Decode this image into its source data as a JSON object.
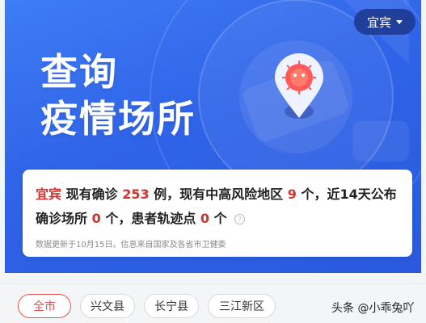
{
  "header": {
    "city": "宜宾",
    "title_line1": "查询",
    "title_line2": "疫情场所"
  },
  "summary": {
    "city": "宜宾",
    "t1": "现有确诊",
    "confirmed": "253",
    "t2": "例，现有中高风险地区",
    "risk_areas": "9",
    "t3": "个，近14天公布",
    "t4": "确诊场所",
    "places": "0",
    "t5": "个，患者轨迹点",
    "tracks": "0",
    "t6": "个",
    "note": "数据更新于10月15日。信息来自国家及各省市卫健委"
  },
  "tabs": [
    {
      "label": "全市",
      "active": true
    },
    {
      "label": "兴文县",
      "active": false
    },
    {
      "label": "长宁县",
      "active": false
    },
    {
      "label": "三江新区",
      "active": false
    }
  ],
  "watermark": "头条 @小乖兔吖",
  "colors": {
    "banner": "#2f63e8",
    "accent_red": "#d0322d",
    "tab_active": "#e2514c"
  }
}
